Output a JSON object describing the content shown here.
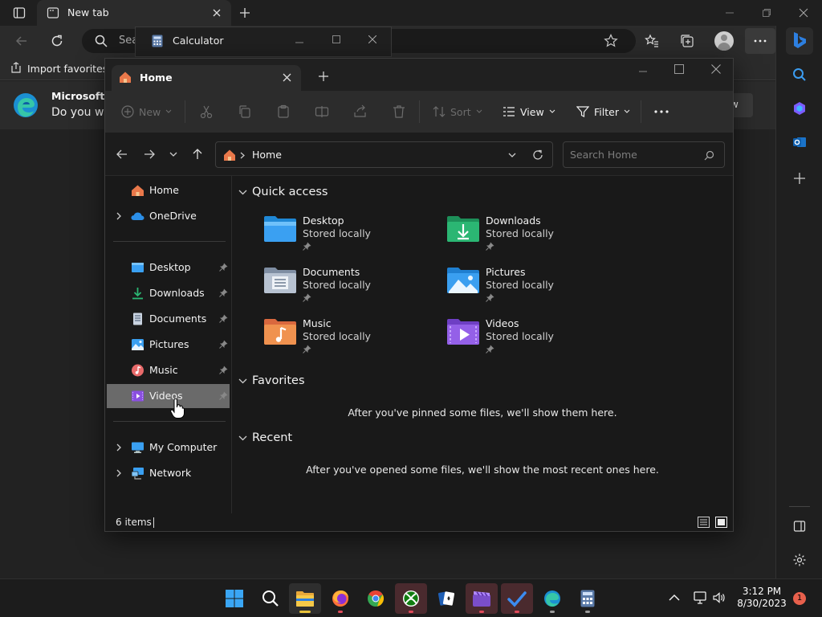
{
  "edge": {
    "tab_title": "New tab",
    "address_placeholder": "Sea",
    "favorites_label": "Import favorites",
    "infobar_title": "Microsoft E",
    "infobar_text": "Do you wa",
    "infobar_button": "w"
  },
  "calculator": {
    "title": "Calculator"
  },
  "explorer": {
    "tab_title": "Home",
    "commands": {
      "new": "New",
      "sort": "Sort",
      "view": "View",
      "filter": "Filter"
    },
    "breadcrumb": "Home",
    "search_placeholder": "Search Home",
    "nav": {
      "home": "Home",
      "onedrive": "OneDrive",
      "desktop": "Desktop",
      "downloads": "Downloads",
      "documents": "Documents",
      "pictures": "Pictures",
      "music": "Music",
      "videos": "Videos",
      "my_computer": "My Computer",
      "network": "Network"
    },
    "quick_access": {
      "heading": "Quick access",
      "items": [
        {
          "name": "Desktop",
          "sub": "Stored locally"
        },
        {
          "name": "Downloads",
          "sub": "Stored locally"
        },
        {
          "name": "Documents",
          "sub": "Stored locally"
        },
        {
          "name": "Pictures",
          "sub": "Stored locally"
        },
        {
          "name": "Music",
          "sub": "Stored locally"
        },
        {
          "name": "Videos",
          "sub": "Stored locally"
        }
      ]
    },
    "favorites": {
      "heading": "Favorites",
      "empty": "After you've pinned some files, we'll show them here."
    },
    "recent": {
      "heading": "Recent",
      "empty": "After you've opened some files, we'll show the most recent ones here."
    },
    "status": {
      "item_count": "6 items"
    }
  },
  "taskbar": {
    "time": "3:12 PM",
    "date": "8/30/2023",
    "notification_count": "1"
  },
  "colors": {
    "accent": "#0078d4",
    "folder_blue": "#3aa0f2",
    "folder_green": "#2bb673",
    "selected_nav": "#6a6a6a"
  }
}
